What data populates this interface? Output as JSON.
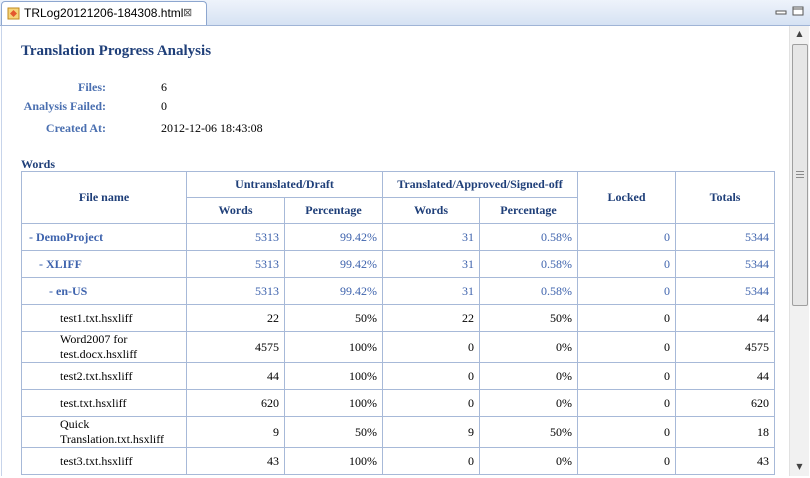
{
  "tab": {
    "title": "TRLog20121206-184308.html",
    "close": "⊠"
  },
  "report": {
    "title": "Translation Progress Analysis",
    "meta": [
      {
        "label": "Files:",
        "value": "6"
      },
      {
        "label": "Analysis Failed:",
        "value": "0"
      },
      {
        "label": "Created At:",
        "value": "2012-12-06 18:43:08"
      }
    ],
    "words_label": "Words",
    "headers": {
      "file_name": "File name",
      "untranslated": "Untranslated/Draft",
      "translated": "Translated/Approved/Signed-off",
      "locked": "Locked",
      "totals": "Totals",
      "words": "Words",
      "percentage": "Percentage"
    },
    "rows": [
      {
        "name": "- DemoProject",
        "indent": 0,
        "group": true,
        "u_words": "5313",
        "u_pct": "99.42%",
        "t_words": "31",
        "t_pct": "0.58%",
        "locked": "0",
        "total": "5344"
      },
      {
        "name": "- XLIFF",
        "indent": 1,
        "group": true,
        "u_words": "5313",
        "u_pct": "99.42%",
        "t_words": "31",
        "t_pct": "0.58%",
        "locked": "0",
        "total": "5344"
      },
      {
        "name": "- en-US",
        "indent": 2,
        "group": true,
        "u_words": "5313",
        "u_pct": "99.42%",
        "t_words": "31",
        "t_pct": "0.58%",
        "locked": "0",
        "total": "5344"
      },
      {
        "name": "test1.txt.hsxliff",
        "indent": 3,
        "group": false,
        "u_words": "22",
        "u_pct": "50%",
        "t_words": "22",
        "t_pct": "50%",
        "locked": "0",
        "total": "44"
      },
      {
        "name": "Word2007 for test.docx.hsxliff",
        "indent": 3,
        "group": false,
        "tall": true,
        "u_words": "4575",
        "u_pct": "100%",
        "t_words": "0",
        "t_pct": "0%",
        "locked": "0",
        "total": "4575"
      },
      {
        "name": "test2.txt.hsxliff",
        "indent": 3,
        "group": false,
        "u_words": "44",
        "u_pct": "100%",
        "t_words": "0",
        "t_pct": "0%",
        "locked": "0",
        "total": "44"
      },
      {
        "name": "test.txt.hsxliff",
        "indent": 3,
        "group": false,
        "u_words": "620",
        "u_pct": "100%",
        "t_words": "0",
        "t_pct": "0%",
        "locked": "0",
        "total": "620"
      },
      {
        "name": "Quick Translation.txt.hsxliff",
        "indent": 3,
        "group": false,
        "tall": true,
        "u_words": "9",
        "u_pct": "50%",
        "t_words": "9",
        "t_pct": "50%",
        "locked": "0",
        "total": "18"
      },
      {
        "name": "test3.txt.hsxliff",
        "indent": 3,
        "group": false,
        "u_words": "43",
        "u_pct": "100%",
        "t_words": "0",
        "t_pct": "0%",
        "locked": "0",
        "total": "43"
      }
    ]
  }
}
